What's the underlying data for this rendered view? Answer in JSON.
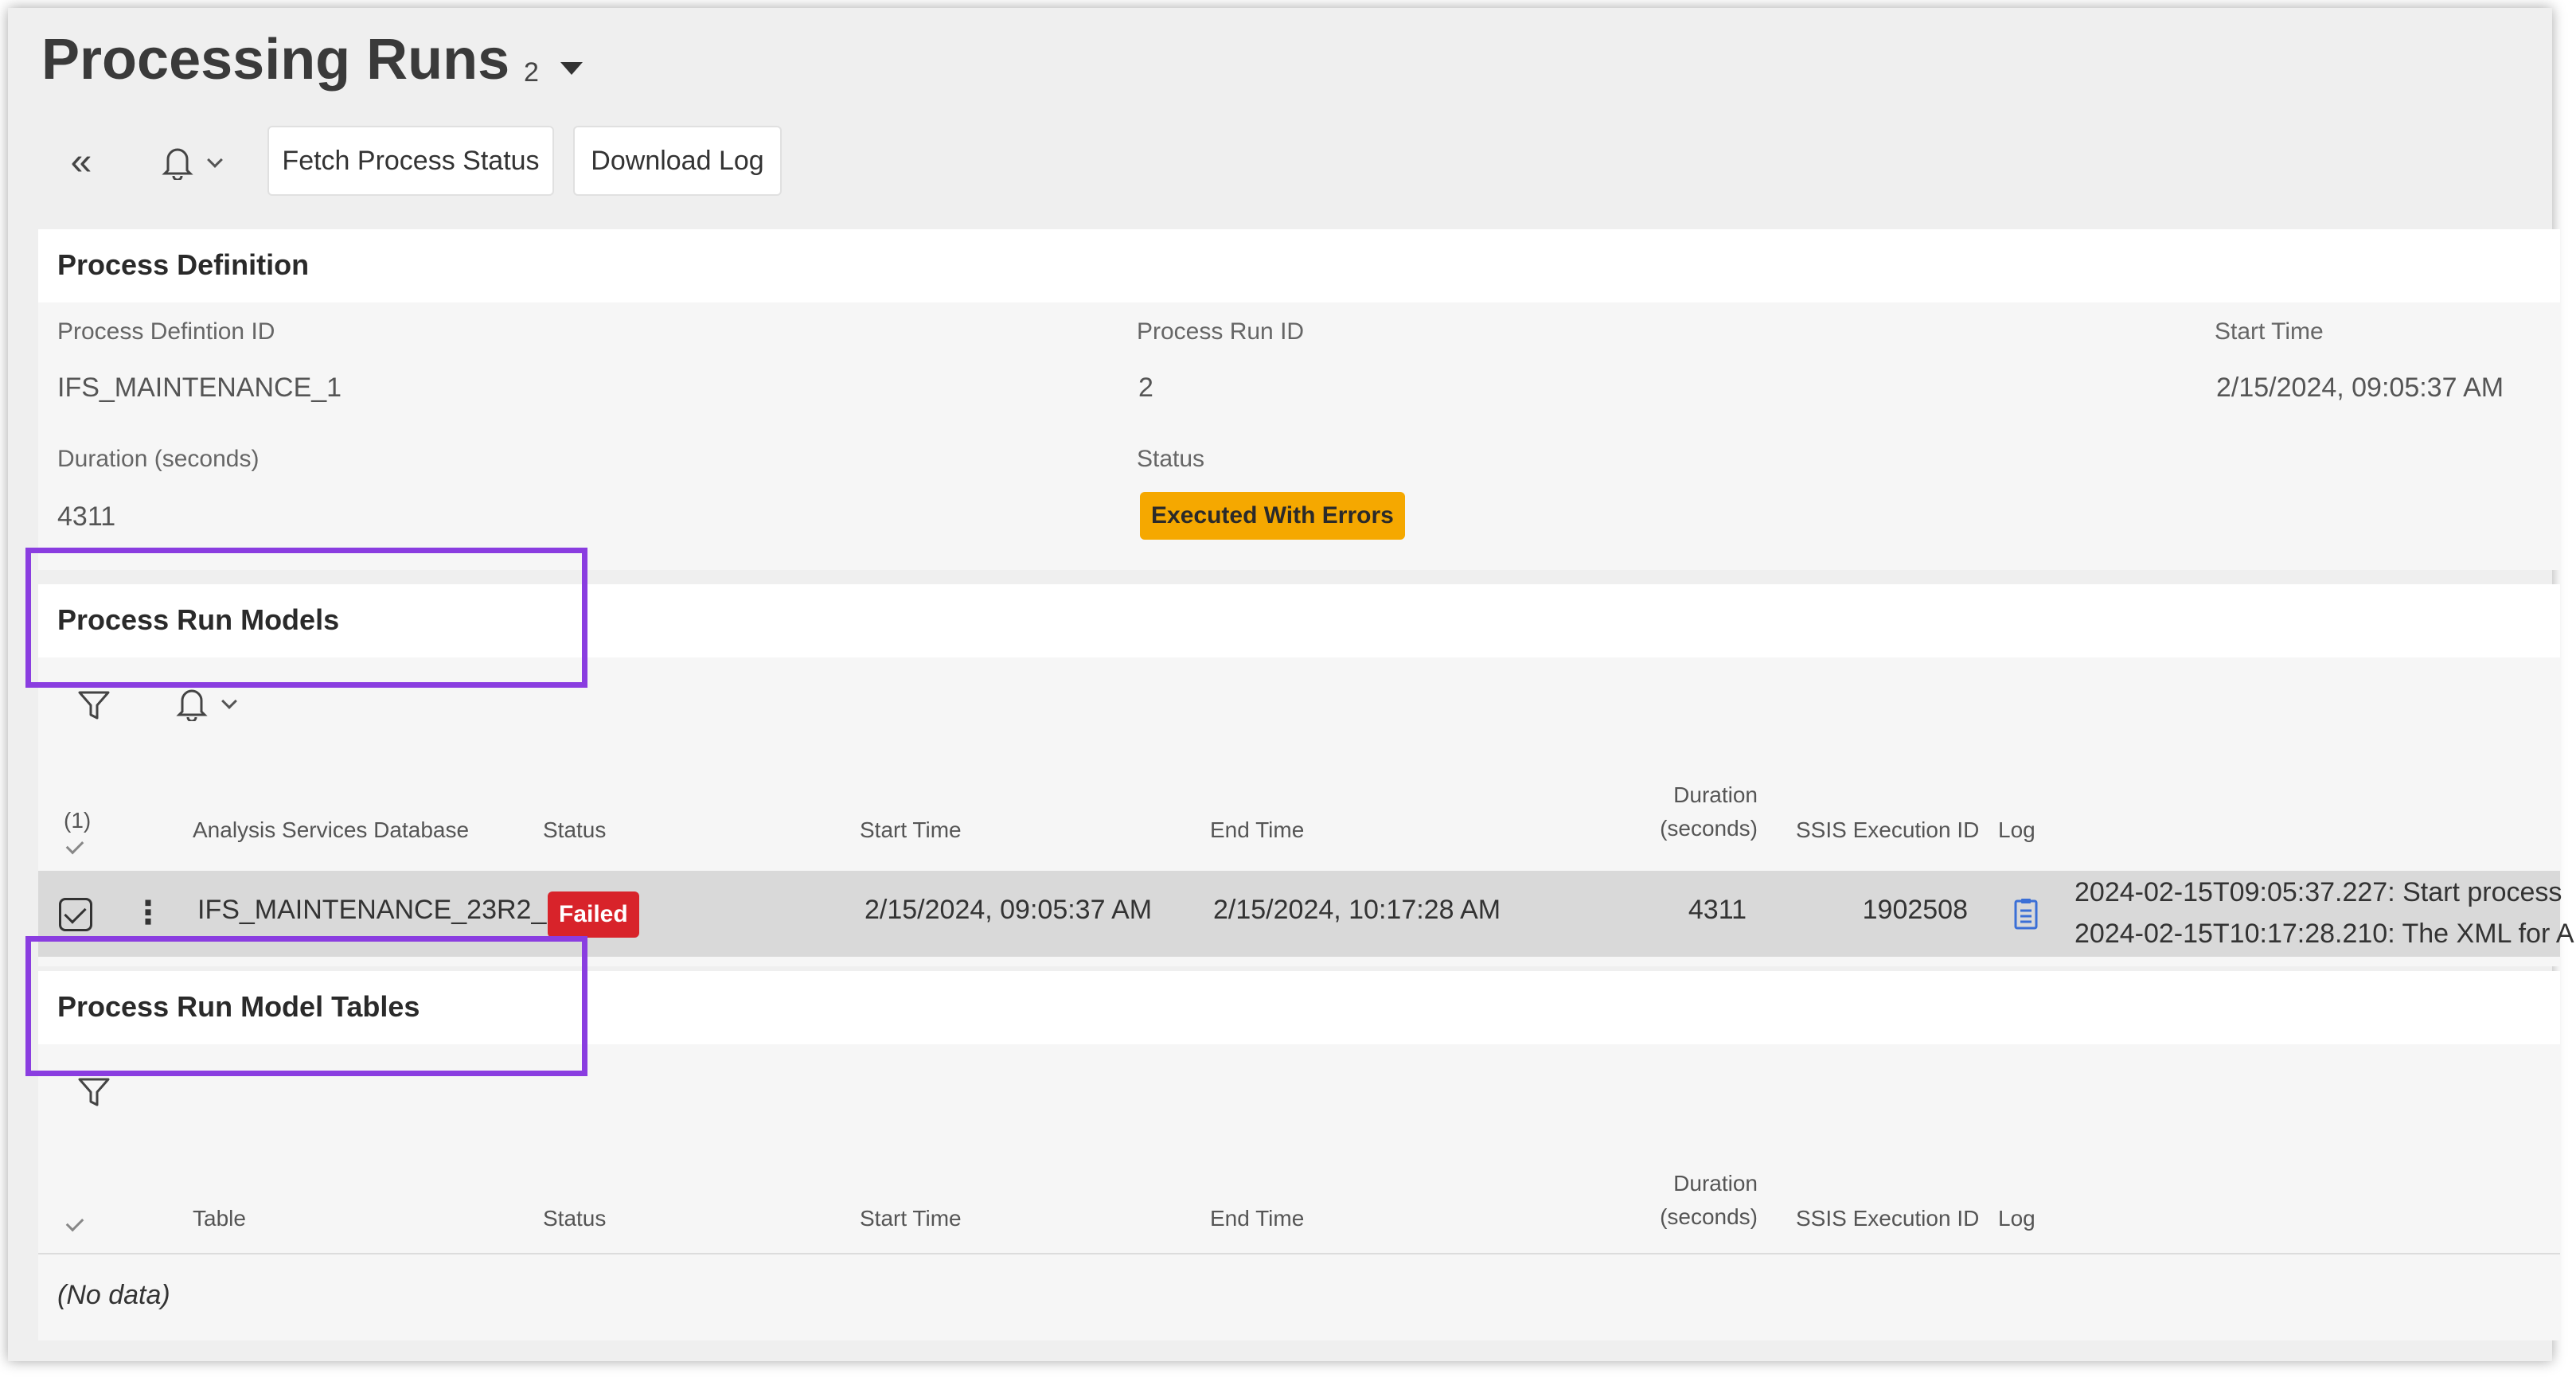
{
  "header": {
    "title": "Processing Runs",
    "count": "2"
  },
  "toolbar": {
    "fetch_label": "Fetch Process Status",
    "download_label": "Download Log"
  },
  "process_definition": {
    "section_title": "Process Definition",
    "fields": {
      "definition_id_label": "Process Defintion ID",
      "definition_id_value": "IFS_MAINTENANCE_1",
      "run_id_label": "Process Run ID",
      "run_id_value": "2",
      "start_time_label": "Start Time",
      "start_time_value": "2/15/2024, 09:05:37 AM",
      "duration_label": "Duration (seconds)",
      "duration_value": "4311",
      "status_label": "Status",
      "status_value": "Executed With Errors"
    }
  },
  "process_run_models": {
    "section_title": "Process Run Models",
    "selection_count": "(1)",
    "columns": {
      "database": "Analysis Services Database",
      "status": "Status",
      "start_time": "Start Time",
      "end_time": "End Time",
      "duration_line1": "Duration",
      "duration_line2": "(seconds)",
      "ssis_id": "SSIS Execution ID",
      "log": "Log"
    },
    "rows": [
      {
        "database": "IFS_MAINTENANCE_23R2_",
        "status": "Failed",
        "start_time": "2/15/2024, 09:05:37 AM",
        "end_time": "2/15/2024, 10:17:28 AM",
        "duration": "4311",
        "ssis_id": "1902508",
        "log_line1": "2024-02-15T09:05:37.227: Start process",
        "log_line2": "2024-02-15T10:17:28.210: The XML for A"
      }
    ]
  },
  "process_run_model_tables": {
    "section_title": "Process Run Model Tables",
    "columns": {
      "table": "Table",
      "status": "Status",
      "start_time": "Start Time",
      "end_time": "End Time",
      "duration_line1": "Duration",
      "duration_line2": "(seconds)",
      "ssis_id": "SSIS Execution ID",
      "log": "Log"
    },
    "empty_text": "(No data)"
  },
  "icons": {
    "collapse": "double-chevron-left-icon",
    "notify": "bell-icon",
    "filter": "filter-icon",
    "log": "document-icon",
    "menu": "kebab-menu-icon"
  },
  "colors": {
    "warning_badge": "#f5a800",
    "failed_badge": "#d8232a",
    "highlight": "#8a3de0",
    "log_icon": "#3b6fd6"
  }
}
